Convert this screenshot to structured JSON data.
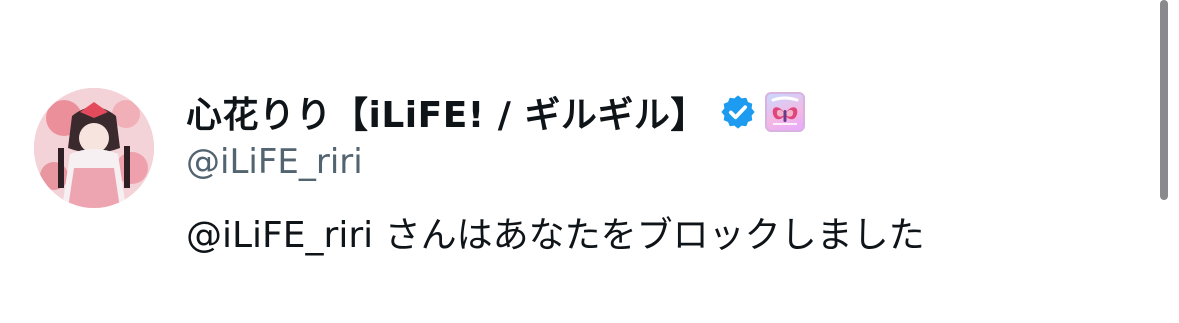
{
  "profile": {
    "display_name": "心花りり【iLiFE! / ギルギル】",
    "handle": "@iLiFE_riri",
    "verified_badge_icon": "verified-check-icon",
    "verified_color": "#1d9bf0",
    "affiliate_badge_icon": "ilife-logo-icon",
    "avatar_icon": "profile-photo"
  },
  "block_notice": {
    "message": "@iLiFE_riri さんはあなたをブロックしました"
  },
  "colors": {
    "primary_text": "#0f1419",
    "secondary_text": "#536471",
    "background": "#ffffff"
  }
}
